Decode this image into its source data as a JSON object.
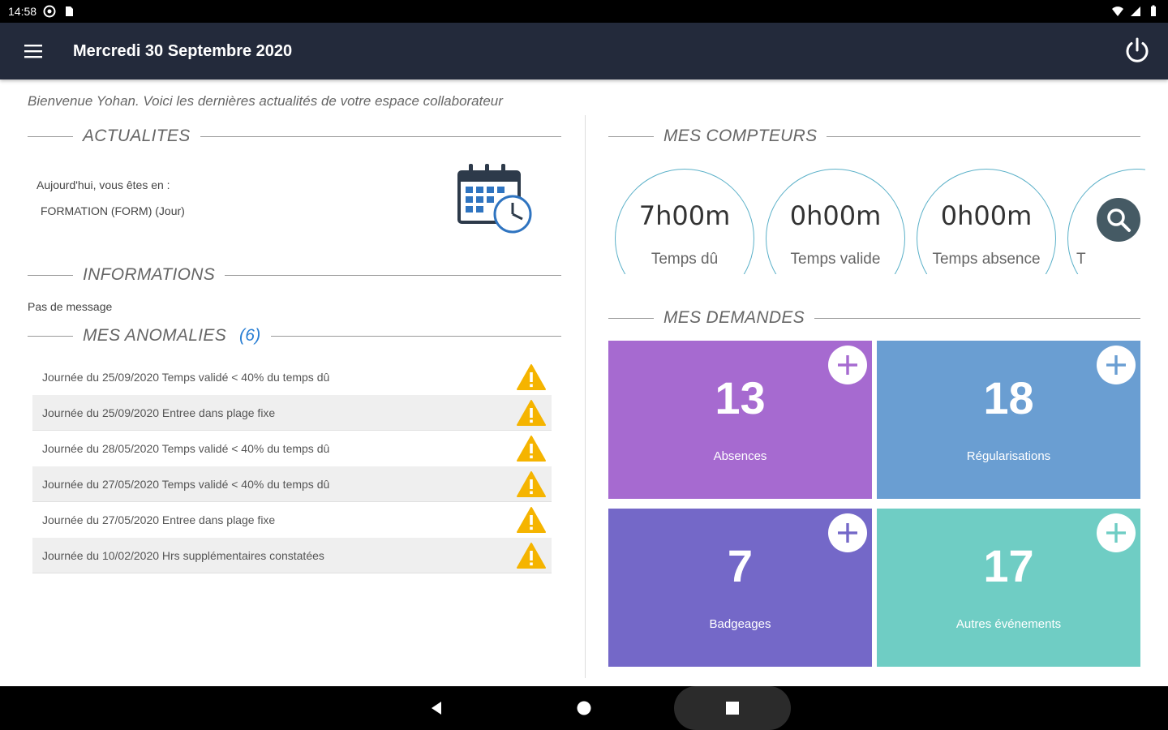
{
  "status_bar": {
    "time": "14:58"
  },
  "app_bar": {
    "title": "Mercredi 30 Septembre 2020"
  },
  "welcome": "Bienvenue Yohan. Voici les dernières actualités de votre espace collaborateur",
  "actualites": {
    "title": "ACTUALITES",
    "line1": "Aujourd'hui, vous êtes en :",
    "line2": "FORMATION (FORM) (Jour)"
  },
  "informations": {
    "title": "INFORMATIONS",
    "message": "Pas de message"
  },
  "anomalies": {
    "title": "MES ANOMALIES",
    "count": "(6)",
    "items": [
      "Journée du 25/09/2020 Temps validé < 40% du temps dû",
      "Journée du 25/09/2020 Entree dans plage fixe",
      "Journée du 28/05/2020 Temps validé < 40% du temps dû",
      "Journée du 27/05/2020 Temps validé < 40% du temps dû",
      "Journée du 27/05/2020 Entree dans plage fixe",
      "Journée du 10/02/2020 Hrs supplémentaires constatées"
    ]
  },
  "compteurs": {
    "title": "MES COMPTEURS",
    "items": [
      {
        "value": "7h00m",
        "label": "Temps dû"
      },
      {
        "value": "0h00m",
        "label": "Temps valide"
      },
      {
        "value": "0h00m",
        "label": "Temps absence"
      },
      {
        "value": "",
        "label": "T"
      }
    ]
  },
  "demandes": {
    "title": "MES DEMANDES",
    "tiles": [
      {
        "count": "13",
        "label": "Absences",
        "color": "#a66ad0"
      },
      {
        "count": "18",
        "label": "Régularisations",
        "color": "#6a9ed2"
      },
      {
        "count": "7",
        "label": "Badgeages",
        "color": "#7468c8"
      },
      {
        "count": "17",
        "label": "Autres événements",
        "color": "#6fcdc4"
      }
    ]
  },
  "colors": {
    "app_bar": "#232a3b",
    "accent": "#2a7fd4",
    "warning": "#f5b400",
    "counter_ring": "#5ab0c8",
    "fab": "#455a64"
  }
}
